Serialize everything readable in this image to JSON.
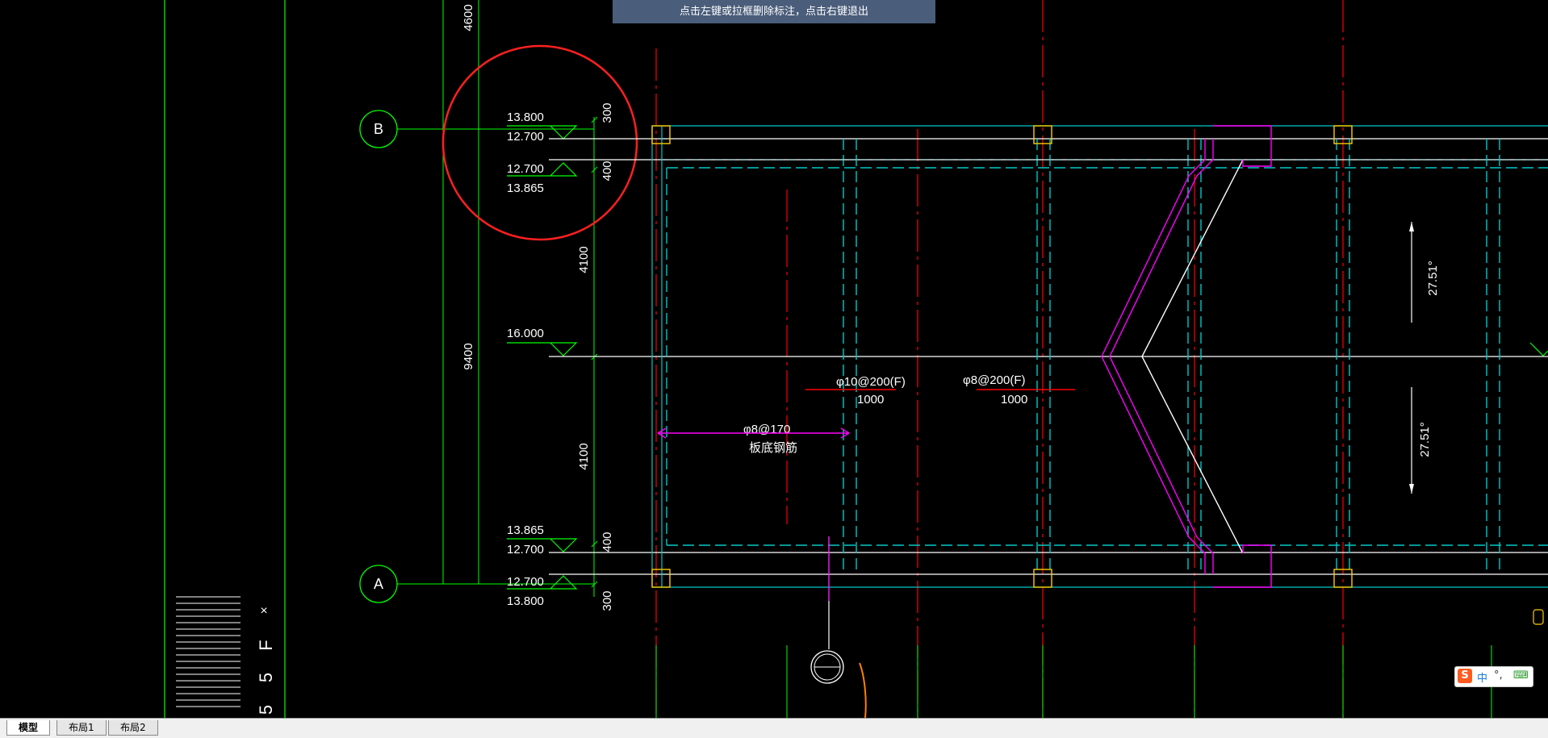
{
  "banner": {
    "text": "点击左键或拉框删除标注，点击右键退出"
  },
  "axes": {
    "top_label": "B",
    "bottom_label": "A"
  },
  "dims": {
    "left_top": "4600",
    "left_mid": "9400",
    "inner_a": "300",
    "inner_b": "400",
    "inner_c": "4100",
    "inner_d": "4100",
    "inner_e": "400",
    "inner_f": "300"
  },
  "elevations": {
    "e1": "13.800",
    "e2": "12.700",
    "e3": "12.700",
    "e4": "13.865",
    "e5": "16.000",
    "e6": "13.865",
    "e7": "12.700",
    "e8": "12.700",
    "e9": "13.800"
  },
  "rebar": {
    "r1": "φ10@200(F)",
    "r1_len": "1000",
    "r2": "φ8@200(F)",
    "r2_len": "1000",
    "r3": "φ8@170",
    "r3_note": "板底钢筋"
  },
  "angles": {
    "a1": "27.51°",
    "a2": "27.51°"
  },
  "ucs": {
    "x_label": "×",
    "y_chars": [
      "F",
      "5",
      "5"
    ]
  },
  "tabs": [
    "模型",
    "布局1",
    "布局2"
  ],
  "ime": {
    "logo": "S",
    "mode": "中",
    "punct": "°,",
    "kbd": "⌨"
  },
  "colors": {
    "banner": "#4a5d7a",
    "axis": "#00ff00",
    "cyan": "#00c8c8",
    "red": "#ff0000",
    "magenta": "#ff00ff",
    "yellow": "#ffcc00"
  }
}
